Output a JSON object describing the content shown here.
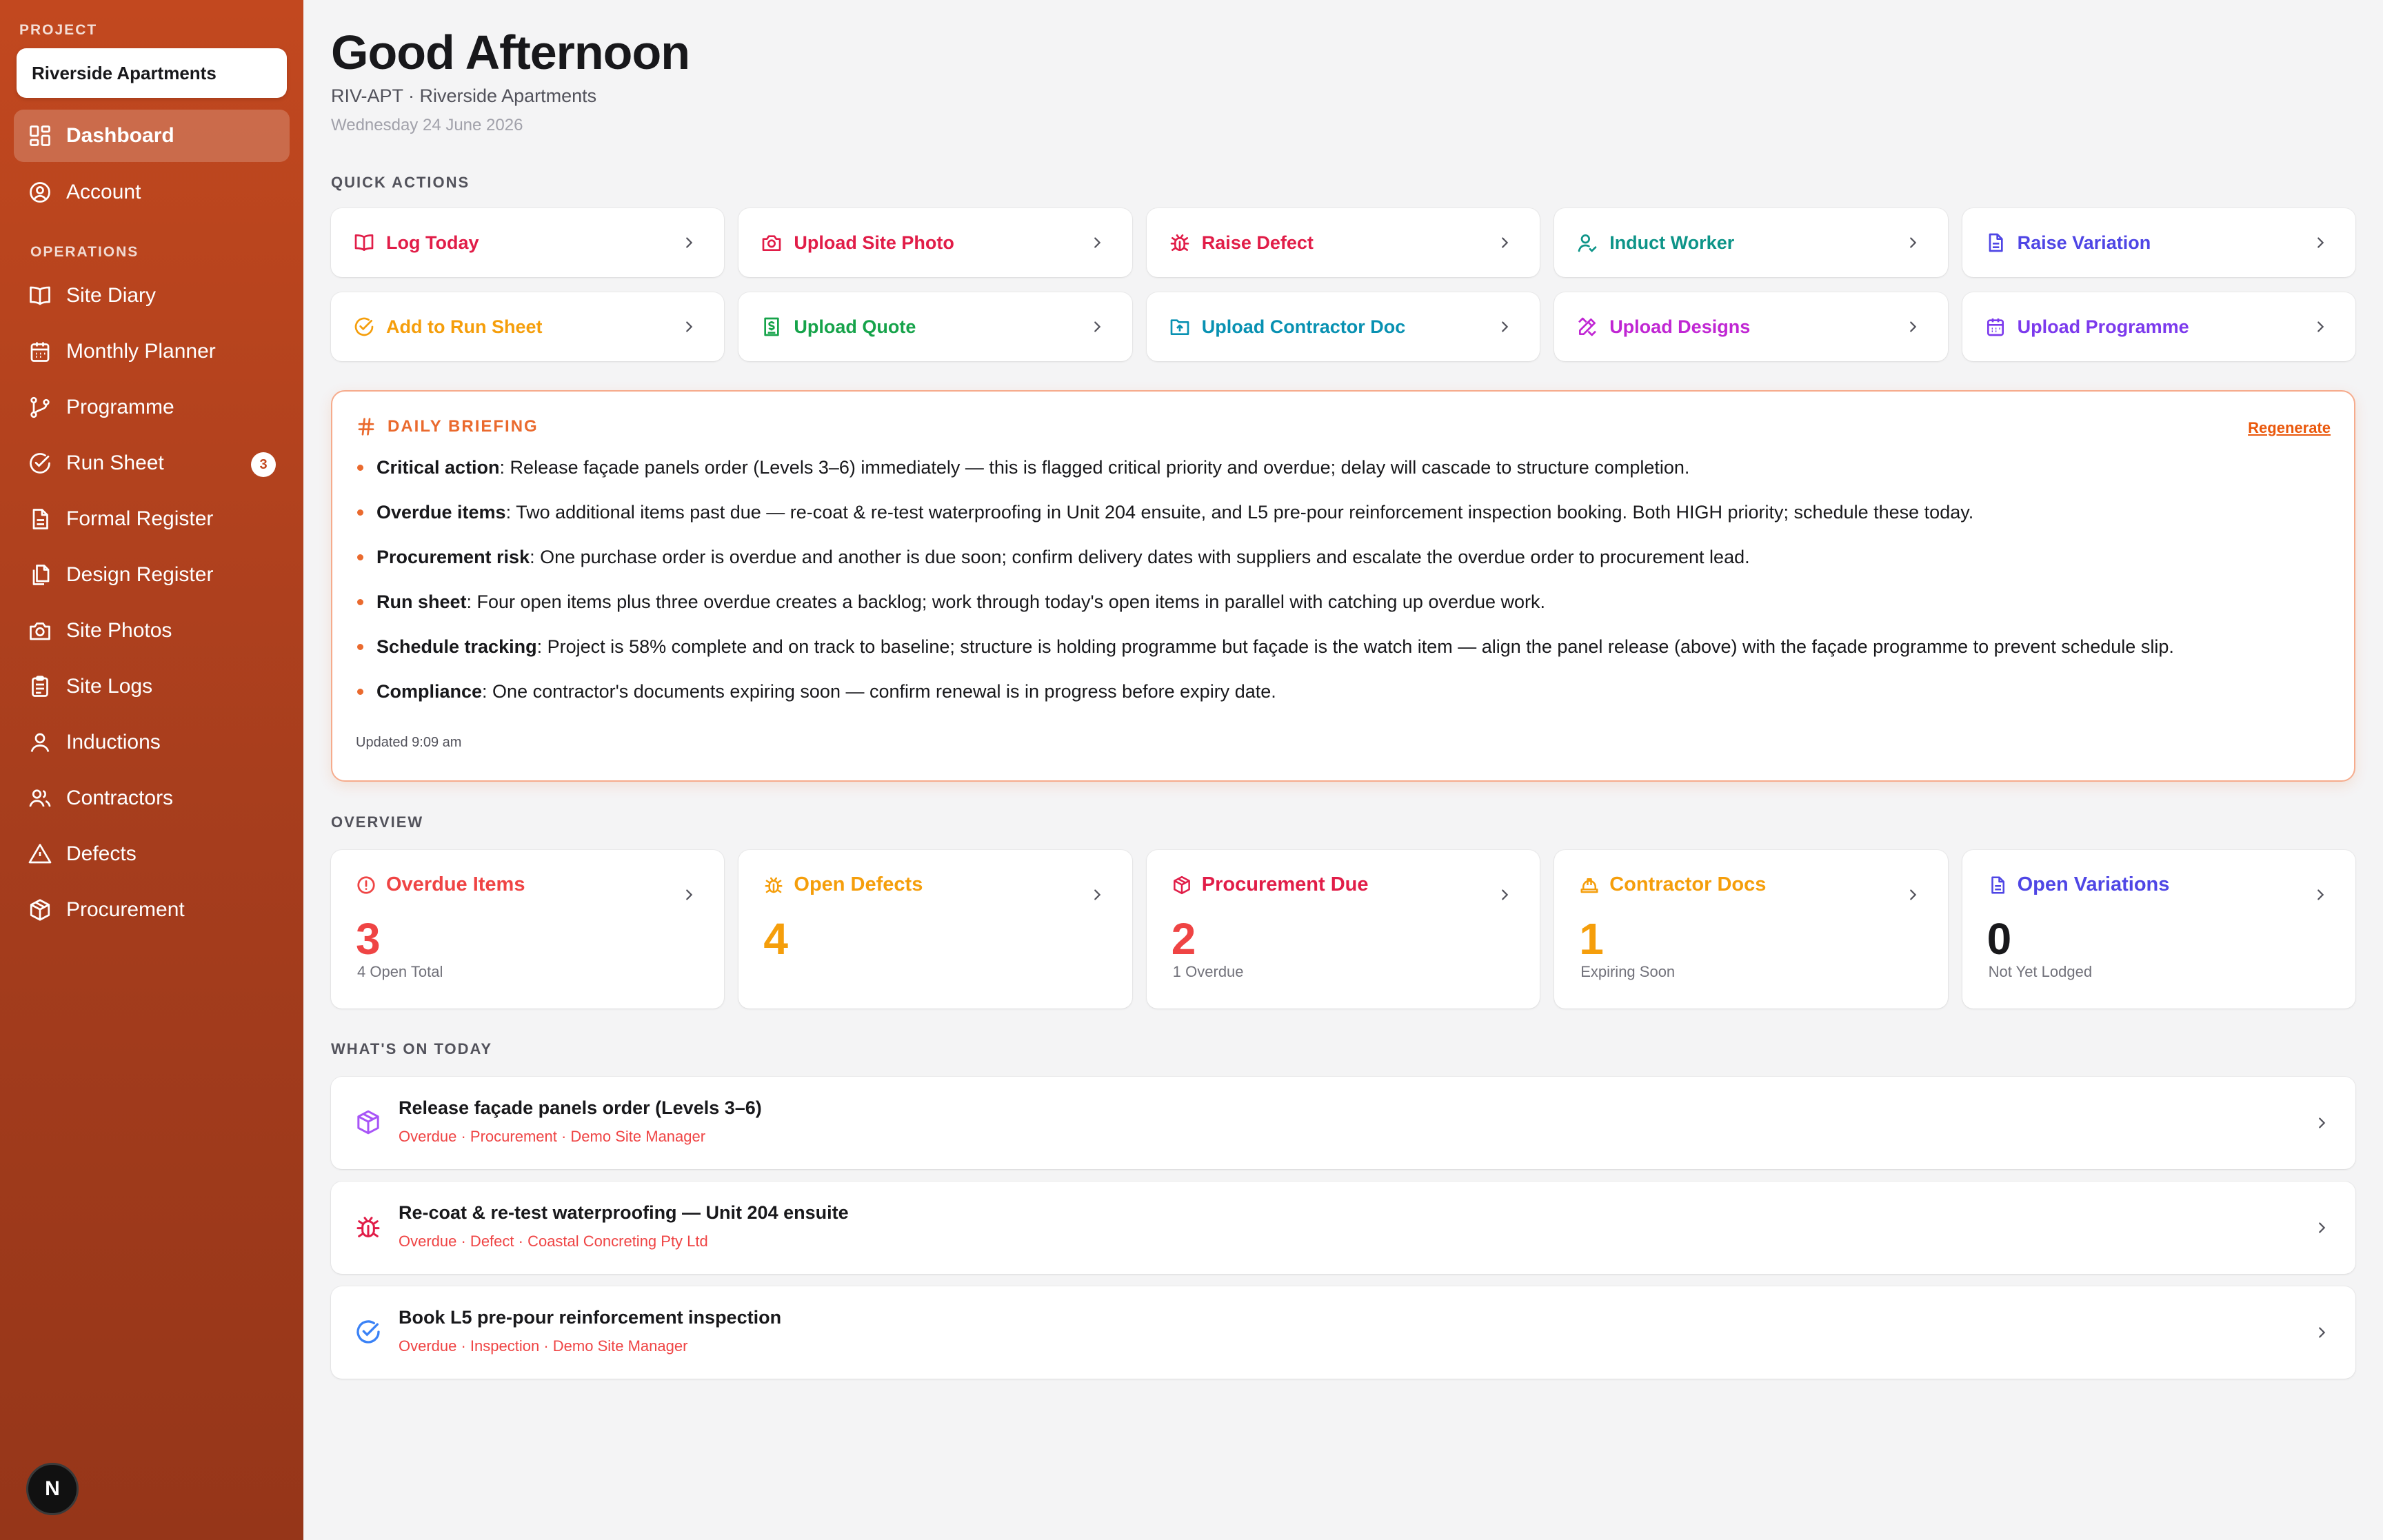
{
  "sidebar": {
    "project_label": "PROJECT",
    "project_name": "Riverside Apartments",
    "nav_top": [
      {
        "label": "Dashboard",
        "icon": "dashboard-icon",
        "active": true
      },
      {
        "label": "Account",
        "icon": "account-circle-icon"
      }
    ],
    "section_label": "OPERATIONS",
    "nav_ops": [
      {
        "label": "Site Diary",
        "icon": "book-icon"
      },
      {
        "label": "Monthly Planner",
        "icon": "calendar-icon"
      },
      {
        "label": "Programme",
        "icon": "git-branch-icon"
      },
      {
        "label": "Run Sheet",
        "icon": "check-circle-icon",
        "badge": "3"
      },
      {
        "label": "Formal Register",
        "icon": "document-icon"
      },
      {
        "label": "Design Register",
        "icon": "files-icon"
      },
      {
        "label": "Site Photos",
        "icon": "camera-icon"
      },
      {
        "label": "Site Logs",
        "icon": "clipboard-icon"
      },
      {
        "label": "Inductions",
        "icon": "user-icon"
      },
      {
        "label": "Contractors",
        "icon": "users-icon"
      },
      {
        "label": "Defects",
        "icon": "warning-triangle-icon"
      },
      {
        "label": "Procurement",
        "icon": "package-icon"
      }
    ],
    "avatar_initial": "N"
  },
  "header": {
    "greeting": "Good Afternoon",
    "subtitle": "RIV-APT · Riverside Apartments",
    "date": "Wednesday 24 June 2026"
  },
  "quick_actions": {
    "label": "QUICK ACTIONS",
    "items": [
      {
        "label": "Log Today",
        "icon": "book-icon",
        "color": "#e11d48"
      },
      {
        "label": "Upload Site Photo",
        "icon": "camera-icon",
        "color": "#e11d48"
      },
      {
        "label": "Raise Defect",
        "icon": "bug-icon",
        "color": "#e11d48"
      },
      {
        "label": "Induct Worker",
        "icon": "user-check-icon",
        "color": "#0d9488"
      },
      {
        "label": "Raise Variation",
        "icon": "document-icon",
        "color": "#4f46e5"
      },
      {
        "label": "Add to Run Sheet",
        "icon": "check-circle-icon",
        "color": "#f59e0b"
      },
      {
        "label": "Upload Quote",
        "icon": "receipt-icon",
        "color": "#16a34a"
      },
      {
        "label": "Upload Contractor Doc",
        "icon": "folder-upload-icon",
        "color": "#0891b2"
      },
      {
        "label": "Upload Designs",
        "icon": "pencil-ruler-icon",
        "color": "#c026d3"
      },
      {
        "label": "Upload Programme",
        "icon": "calendar-icon",
        "color": "#7c3aed"
      }
    ]
  },
  "briefing": {
    "title": "DAILY BRIEFING",
    "regenerate_label": "Regenerate",
    "items": [
      {
        "head": "Critical action",
        "text": ": Release façade panels order (Levels 3–6) immediately — this is flagged critical priority and overdue; delay will cascade to structure completion."
      },
      {
        "head": "Overdue items",
        "text": ": Two additional items past due — re-coat & re-test waterproofing in Unit 204 ensuite, and L5 pre-pour reinforcement inspection booking. Both HIGH priority; schedule these today."
      },
      {
        "head": "Procurement risk",
        "text": ": One purchase order is overdue and another is due soon; confirm delivery dates with suppliers and escalate the overdue order to procurement lead."
      },
      {
        "head": "Run sheet",
        "text": ": Four open items plus three overdue creates a backlog; work through today's open items in parallel with catching up overdue work."
      },
      {
        "head": "Schedule tracking",
        "text": ": Project is 58% complete and on track to baseline; structure is holding programme but façade is the watch item — align the panel release (above) with the façade programme to prevent schedule slip."
      },
      {
        "head": "Compliance",
        "text": ": One contractor's documents expiring soon — confirm renewal is in progress before expiry date."
      }
    ],
    "updated": "Updated 9:09 am"
  },
  "overview": {
    "label": "OVERVIEW",
    "cards": [
      {
        "title": "Overdue Items",
        "icon": "alert-circle-icon",
        "value": "3",
        "sub": "4 Open Total",
        "color": "#ef4444",
        "value_color": "#ef4444"
      },
      {
        "title": "Open Defects",
        "icon": "bug-icon",
        "value": "4",
        "sub": "",
        "color": "#f59e0b",
        "value_color": "#f59e0b"
      },
      {
        "title": "Procurement Due",
        "icon": "package-icon",
        "value": "2",
        "sub": "1 Overdue",
        "color": "#e11d48",
        "value_color": "#ef4444"
      },
      {
        "title": "Contractor Docs",
        "icon": "hard-hat-icon",
        "value": "1",
        "sub": "Expiring Soon",
        "color": "#f59e0b",
        "value_color": "#f59e0b"
      },
      {
        "title": "Open Variations",
        "icon": "document-icon",
        "value": "0",
        "sub": "Not Yet Lodged",
        "color": "#4f46e5",
        "value_color": "#18181b"
      }
    ]
  },
  "today": {
    "label": "WHAT'S ON TODAY",
    "items": [
      {
        "title": "Release façade panels order (Levels 3–6)",
        "meta": "Overdue · Procurement · Demo Site Manager",
        "icon": "package-icon",
        "color": "#a855f7"
      },
      {
        "title": "Re-coat & re-test waterproofing — Unit 204 ensuite",
        "meta": "Overdue · Defect · Coastal Concreting Pty Ltd",
        "icon": "bug-icon",
        "color": "#e11d48"
      },
      {
        "title": "Book L5 pre-pour reinforcement inspection",
        "meta": "Overdue · Inspection · Demo Site Manager",
        "icon": "check-circle-icon",
        "color": "#3b82f6"
      }
    ]
  }
}
